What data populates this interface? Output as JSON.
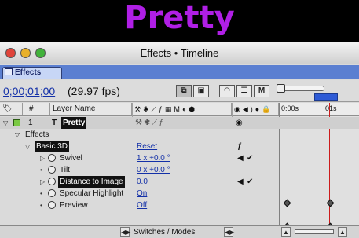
{
  "banner": {
    "title": "Pretty"
  },
  "window": {
    "title": "Effects • Timeline"
  },
  "tab": {
    "label": "Effects"
  },
  "info": {
    "timecode": "0;00;01;00",
    "fps": "(29.97 fps)"
  },
  "toolbar": {
    "m_label": "M"
  },
  "columns": {
    "hash": "#",
    "layer_name": "Layer Name"
  },
  "ruler": {
    "start": "0:00s",
    "mark": "01s"
  },
  "layer": {
    "number": "1",
    "name": "Pretty"
  },
  "tree": {
    "effects": "Effects",
    "basic3d": "Basic 3D",
    "reset": "Reset",
    "swivel": {
      "label": "Swivel",
      "value": "1 x +0.0 °"
    },
    "tilt": {
      "label": "Tilt",
      "value": "0 x +0.0 °"
    },
    "distance": {
      "label": "Distance to Image",
      "value": "0.0"
    },
    "specular": {
      "label": "Specular Highlight",
      "value": "On"
    },
    "preview": {
      "label": "Preview",
      "value": "Off"
    }
  },
  "status": {
    "switches_modes": "Switches / Modes"
  },
  "colors": {
    "banner_text": "#b01fe6",
    "tab_bar": "#5b7fd1",
    "timecode": "#1330a8",
    "timebar": "#78c83a",
    "cti": "#cc1b1b"
  }
}
